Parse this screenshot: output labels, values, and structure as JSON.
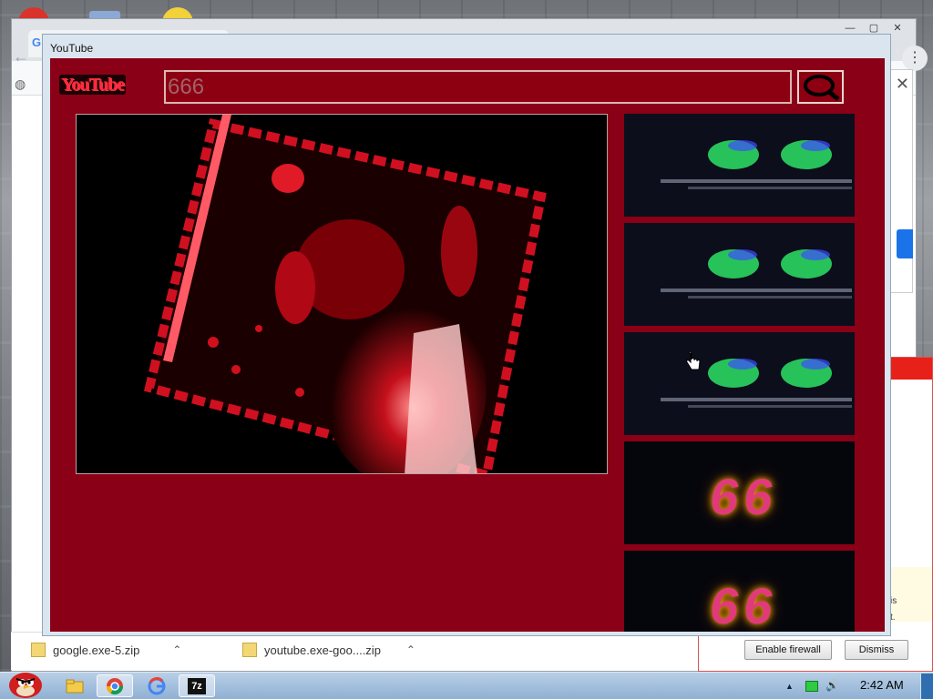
{
  "youtube_window": {
    "title": "YouTube",
    "logo_text": "YouTube",
    "search": {
      "value": "666"
    }
  },
  "sidebar": {
    "thumbnails": [
      {
        "kind": "green-glitch"
      },
      {
        "kind": "green-glitch"
      },
      {
        "kind": "green-glitch"
      },
      {
        "kind": "digits",
        "digits": "66"
      },
      {
        "kind": "digits",
        "digits": "66"
      }
    ]
  },
  "browser": {
    "tab_icon_letter": "G",
    "window_controls": {
      "minimize": "—",
      "maximize": "▢",
      "close": "✕"
    },
    "back_icon": "←",
    "globe_icon": "◍",
    "menu_icon": "⋮",
    "panel_close": "✕"
  },
  "downloads": [
    {
      "name": "google.exe-5.zip"
    },
    {
      "name": "youtube.exe-goo....zip"
    }
  ],
  "notification": {
    "text_is": "is",
    "text_t": "t.",
    "enable_label": "Enable firewall",
    "dismiss_label": "Dismiss"
  },
  "taskbar": {
    "tray_arrow": "▲",
    "volume_icon": "🔊",
    "time": "2:42 AM",
    "seven_zip_label": "7z"
  },
  "colors": {
    "yt_background": "#8a0016",
    "search_border": "#d9b6b6",
    "notification_accent": "#e8201a"
  }
}
